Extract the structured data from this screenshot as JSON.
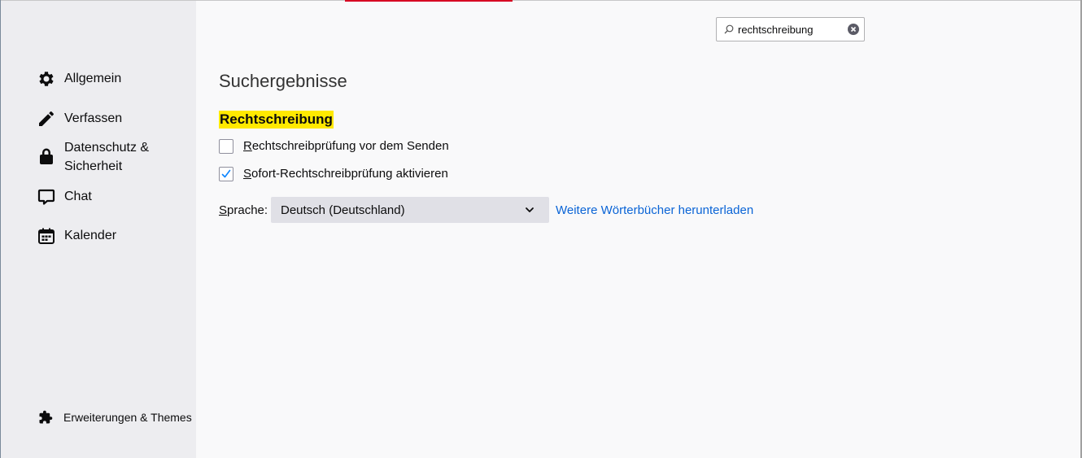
{
  "sidebar": {
    "categories": [
      {
        "label": "Allgemein",
        "icon": "gear-icon"
      },
      {
        "label": "Verfassen",
        "icon": "pencil-icon"
      },
      {
        "label_line1": "Datenschutz &",
        "label_line2": "Sicherheit",
        "icon": "lock-icon"
      },
      {
        "label": "Chat",
        "icon": "chat-bubble-icon"
      },
      {
        "label": "Kalender",
        "icon": "calendar-icon"
      }
    ],
    "footer": {
      "label": "Erweiterungen & Themes",
      "icon": "puzzle-piece-icon"
    }
  },
  "search": {
    "value": "rechtschreibung",
    "icon": "search-icon",
    "clear_icon": "clear-circle-icon"
  },
  "main": {
    "title": "Suchergebnisse",
    "group": {
      "title": "Rechtschreibung",
      "options": [
        {
          "label_access": "R",
          "label_rest": "echtschreibprüfung vor dem Senden",
          "checked": false
        },
        {
          "label_access": "S",
          "label_rest": "ofort-Rechtschreibprüfung aktivieren",
          "checked": true
        }
      ],
      "language": {
        "label_access": "S",
        "label_rest": "prache:",
        "selected": "Deutsch (Deutschland)",
        "link": "Weitere Wörterbücher herunterladen"
      }
    }
  },
  "colors": {
    "highlight": "#ffe900",
    "link": "#0a64d6",
    "sidebar_bg": "#ededf0",
    "content_bg": "#f9f9fa",
    "checkmark": "#0a84ff"
  }
}
